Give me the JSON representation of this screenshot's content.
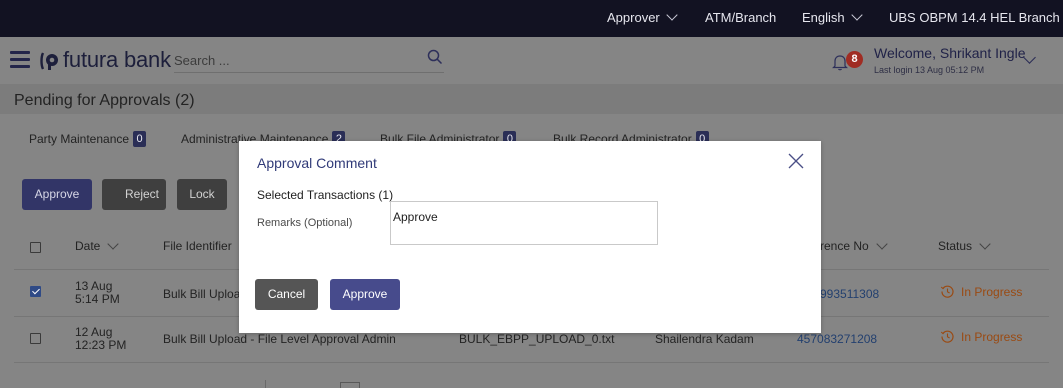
{
  "topbar": {
    "role": "Approver",
    "location": "ATM/Branch",
    "language": "English",
    "entity": "UBS OBPM 14.4 HEL Branch"
  },
  "header": {
    "brand": "futura bank",
    "search_placeholder": "Search ...",
    "notification_count": "8",
    "welcome": "Welcome, Shrikant Ingle",
    "last_login": "Last login 13 Aug 05:12 PM"
  },
  "page": {
    "title": "Pending for Approvals (2)"
  },
  "tabs": [
    {
      "label": "Party Maintenance",
      "count": "0"
    },
    {
      "label": "Administrative Maintenance",
      "count": "2"
    },
    {
      "label": "Bulk File Administrator",
      "count": "0"
    },
    {
      "label": "Bulk Record Administrator",
      "count": "0"
    }
  ],
  "actions": {
    "approve": "Approve",
    "reject": "Reject",
    "lock": "Lock"
  },
  "table": {
    "columns": {
      "date": "Date",
      "file_identifier": "File Identifier",
      "reference_no": "rence No",
      "status": "Status"
    },
    "rows": [
      {
        "checked": true,
        "date_line1": "13 Aug",
        "date_line2": "5:14 PM",
        "file_identifier": "Bulk Bill Uploa",
        "file_name": "",
        "initiated_by": "",
        "reference_no": "993511308",
        "status": "In Progress"
      },
      {
        "checked": false,
        "date_line1": "12 Aug",
        "date_line2": "12:23 PM",
        "file_identifier": "Bulk Bill Upload - File Level Approval Admin",
        "file_name": "BULK_EBPP_UPLOAD_0.txt",
        "initiated_by": "Shailendra Kadam",
        "reference_no": "457083271208",
        "status": "In Progress"
      }
    ]
  },
  "modal": {
    "title": "Approval Comment",
    "selected_transactions": "Selected Transactions (1)",
    "remarks_label": "Remarks (Optional)",
    "remarks_value": "Approve",
    "cancel": "Cancel",
    "approve": "Approve"
  },
  "colors": {
    "topbar_bg": "#121222",
    "primary": "#474b8c",
    "status_in_progress": "#9a4a12",
    "notification_badge": "#a02c23"
  }
}
